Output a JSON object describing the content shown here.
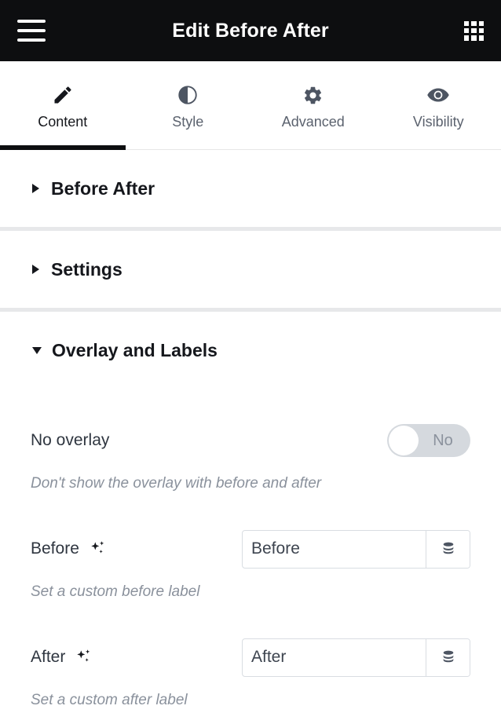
{
  "topbar": {
    "menu_icon": "hamburger-menu-icon",
    "title": "Edit Before After",
    "apps_icon": "grid-apps-icon"
  },
  "tabs": [
    {
      "label": "Content",
      "icon": "pencil-icon",
      "active": true
    },
    {
      "label": "Style",
      "icon": "contrast-circle-icon",
      "active": false
    },
    {
      "label": "Advanced",
      "icon": "gear-icon",
      "active": false
    },
    {
      "label": "Visibility",
      "icon": "eye-icon",
      "active": false
    }
  ],
  "sections": {
    "before_after": {
      "title": "Before After",
      "expanded": false
    },
    "settings": {
      "title": "Settings",
      "expanded": false
    },
    "overlay_labels": {
      "title": "Overlay and Labels",
      "expanded": true
    }
  },
  "controls": {
    "no_overlay": {
      "label": "No overlay",
      "toggle_value": "No",
      "description": "Don't show the overlay with before and after"
    },
    "before": {
      "label": "Before",
      "ai_icon": "sparkle-ai-icon",
      "value": "Before",
      "placeholder": "Before",
      "addon_icon": "database-icon",
      "description": "Set a custom before label"
    },
    "after": {
      "label": "After",
      "ai_icon": "sparkle-ai-icon",
      "value": "After",
      "placeholder": "After",
      "addon_icon": "database-icon",
      "description": "Set a custom after label"
    }
  },
  "colors": {
    "topbar_bg": "#0d0e10",
    "accent": "#0d0e10",
    "divider": "#e7e8ea",
    "muted_text": "#8a919c",
    "toggle_track": "#d5d9de"
  }
}
